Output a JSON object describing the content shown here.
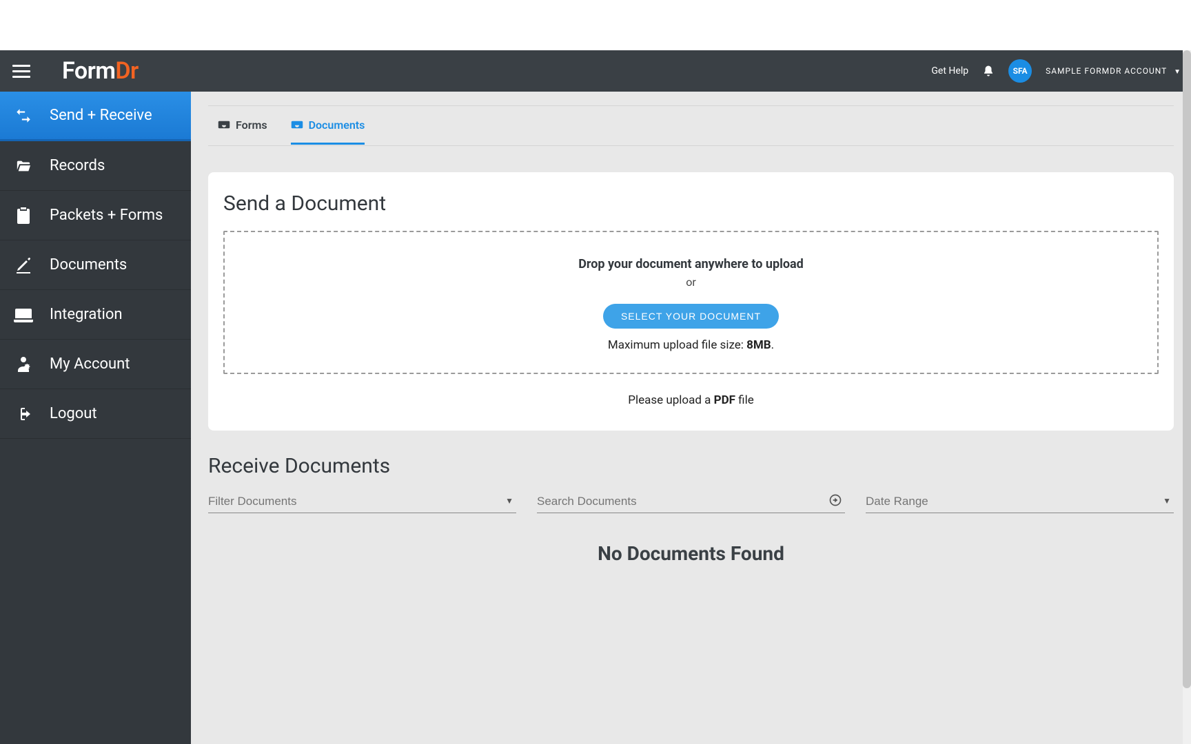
{
  "header": {
    "logo_form": "Form",
    "logo_dr": "Dr",
    "get_help": "Get Help",
    "avatar_initials": "SFA",
    "account_name": "SAMPLE FORMDR ACCOUNT"
  },
  "sidebar": {
    "items": [
      {
        "label": "Send + Receive",
        "icon": "swap-icon",
        "active": true
      },
      {
        "label": "Records",
        "icon": "folder-open-icon",
        "active": false
      },
      {
        "label": "Packets + Forms",
        "icon": "clipboard-plus-icon",
        "active": false
      },
      {
        "label": "Documents",
        "icon": "document-edit-icon",
        "active": false
      },
      {
        "label": "Integration",
        "icon": "laptop-icon",
        "active": false
      },
      {
        "label": "My Account",
        "icon": "user-cog-icon",
        "active": false
      },
      {
        "label": "Logout",
        "icon": "signout-icon",
        "active": false
      }
    ]
  },
  "tabs": {
    "forms_label": "Forms",
    "documents_label": "Documents"
  },
  "send_section": {
    "title": "Send a Document",
    "drop_heading": "Drop your document anywhere to upload",
    "or_text": "or",
    "select_button": "SELECT YOUR DOCUMENT",
    "max_size_prefix": "Maximum upload file size: ",
    "max_size_value": "8MB",
    "max_size_suffix": ".",
    "please_upload_prefix": "Please upload a ",
    "please_upload_type": "PDF",
    "please_upload_suffix": " file"
  },
  "receive_section": {
    "title": "Receive Documents",
    "filter_placeholder": "Filter Documents",
    "search_placeholder": "Search Documents",
    "date_range_placeholder": "Date Range",
    "empty_state": "No Documents Found"
  }
}
